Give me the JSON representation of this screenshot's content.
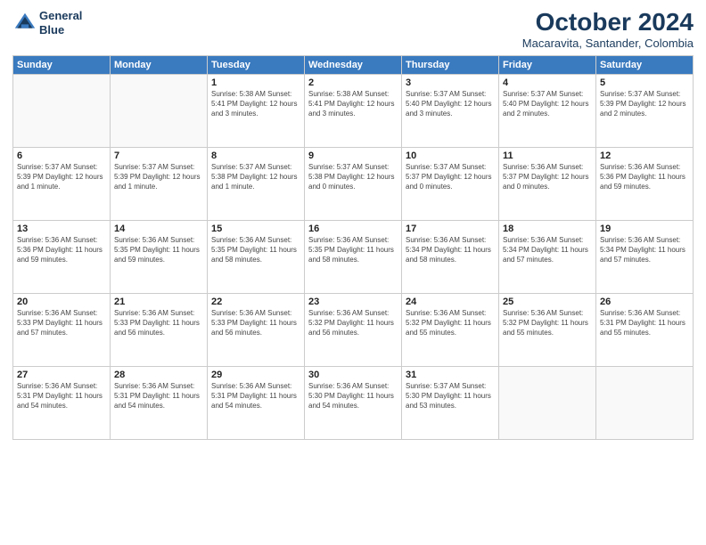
{
  "logo": {
    "line1": "General",
    "line2": "Blue"
  },
  "title": "October 2024",
  "location": "Macaravita, Santander, Colombia",
  "header_days": [
    "Sunday",
    "Monday",
    "Tuesday",
    "Wednesday",
    "Thursday",
    "Friday",
    "Saturday"
  ],
  "weeks": [
    [
      {
        "day": "",
        "detail": ""
      },
      {
        "day": "",
        "detail": ""
      },
      {
        "day": "1",
        "detail": "Sunrise: 5:38 AM\nSunset: 5:41 PM\nDaylight: 12 hours\nand 3 minutes."
      },
      {
        "day": "2",
        "detail": "Sunrise: 5:38 AM\nSunset: 5:41 PM\nDaylight: 12 hours\nand 3 minutes."
      },
      {
        "day": "3",
        "detail": "Sunrise: 5:37 AM\nSunset: 5:40 PM\nDaylight: 12 hours\nand 3 minutes."
      },
      {
        "day": "4",
        "detail": "Sunrise: 5:37 AM\nSunset: 5:40 PM\nDaylight: 12 hours\nand 2 minutes."
      },
      {
        "day": "5",
        "detail": "Sunrise: 5:37 AM\nSunset: 5:39 PM\nDaylight: 12 hours\nand 2 minutes."
      }
    ],
    [
      {
        "day": "6",
        "detail": "Sunrise: 5:37 AM\nSunset: 5:39 PM\nDaylight: 12 hours\nand 1 minute."
      },
      {
        "day": "7",
        "detail": "Sunrise: 5:37 AM\nSunset: 5:39 PM\nDaylight: 12 hours\nand 1 minute."
      },
      {
        "day": "8",
        "detail": "Sunrise: 5:37 AM\nSunset: 5:38 PM\nDaylight: 12 hours\nand 1 minute."
      },
      {
        "day": "9",
        "detail": "Sunrise: 5:37 AM\nSunset: 5:38 PM\nDaylight: 12 hours\nand 0 minutes."
      },
      {
        "day": "10",
        "detail": "Sunrise: 5:37 AM\nSunset: 5:37 PM\nDaylight: 12 hours\nand 0 minutes."
      },
      {
        "day": "11",
        "detail": "Sunrise: 5:36 AM\nSunset: 5:37 PM\nDaylight: 12 hours\nand 0 minutes."
      },
      {
        "day": "12",
        "detail": "Sunrise: 5:36 AM\nSunset: 5:36 PM\nDaylight: 11 hours\nand 59 minutes."
      }
    ],
    [
      {
        "day": "13",
        "detail": "Sunrise: 5:36 AM\nSunset: 5:36 PM\nDaylight: 11 hours\nand 59 minutes."
      },
      {
        "day": "14",
        "detail": "Sunrise: 5:36 AM\nSunset: 5:35 PM\nDaylight: 11 hours\nand 59 minutes."
      },
      {
        "day": "15",
        "detail": "Sunrise: 5:36 AM\nSunset: 5:35 PM\nDaylight: 11 hours\nand 58 minutes."
      },
      {
        "day": "16",
        "detail": "Sunrise: 5:36 AM\nSunset: 5:35 PM\nDaylight: 11 hours\nand 58 minutes."
      },
      {
        "day": "17",
        "detail": "Sunrise: 5:36 AM\nSunset: 5:34 PM\nDaylight: 11 hours\nand 58 minutes."
      },
      {
        "day": "18",
        "detail": "Sunrise: 5:36 AM\nSunset: 5:34 PM\nDaylight: 11 hours\nand 57 minutes."
      },
      {
        "day": "19",
        "detail": "Sunrise: 5:36 AM\nSunset: 5:34 PM\nDaylight: 11 hours\nand 57 minutes."
      }
    ],
    [
      {
        "day": "20",
        "detail": "Sunrise: 5:36 AM\nSunset: 5:33 PM\nDaylight: 11 hours\nand 57 minutes."
      },
      {
        "day": "21",
        "detail": "Sunrise: 5:36 AM\nSunset: 5:33 PM\nDaylight: 11 hours\nand 56 minutes."
      },
      {
        "day": "22",
        "detail": "Sunrise: 5:36 AM\nSunset: 5:33 PM\nDaylight: 11 hours\nand 56 minutes."
      },
      {
        "day": "23",
        "detail": "Sunrise: 5:36 AM\nSunset: 5:32 PM\nDaylight: 11 hours\nand 56 minutes."
      },
      {
        "day": "24",
        "detail": "Sunrise: 5:36 AM\nSunset: 5:32 PM\nDaylight: 11 hours\nand 55 minutes."
      },
      {
        "day": "25",
        "detail": "Sunrise: 5:36 AM\nSunset: 5:32 PM\nDaylight: 11 hours\nand 55 minutes."
      },
      {
        "day": "26",
        "detail": "Sunrise: 5:36 AM\nSunset: 5:31 PM\nDaylight: 11 hours\nand 55 minutes."
      }
    ],
    [
      {
        "day": "27",
        "detail": "Sunrise: 5:36 AM\nSunset: 5:31 PM\nDaylight: 11 hours\nand 54 minutes."
      },
      {
        "day": "28",
        "detail": "Sunrise: 5:36 AM\nSunset: 5:31 PM\nDaylight: 11 hours\nand 54 minutes."
      },
      {
        "day": "29",
        "detail": "Sunrise: 5:36 AM\nSunset: 5:31 PM\nDaylight: 11 hours\nand 54 minutes."
      },
      {
        "day": "30",
        "detail": "Sunrise: 5:36 AM\nSunset: 5:30 PM\nDaylight: 11 hours\nand 54 minutes."
      },
      {
        "day": "31",
        "detail": "Sunrise: 5:37 AM\nSunset: 5:30 PM\nDaylight: 11 hours\nand 53 minutes."
      },
      {
        "day": "",
        "detail": ""
      },
      {
        "day": "",
        "detail": ""
      }
    ]
  ]
}
